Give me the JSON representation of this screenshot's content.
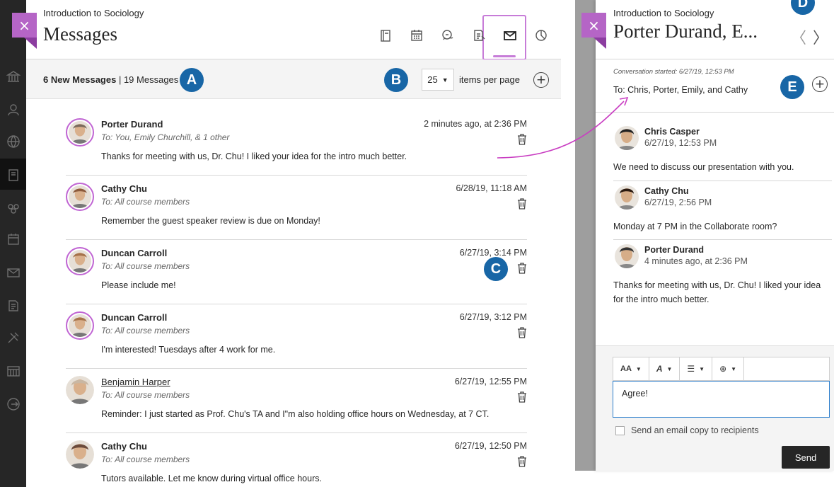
{
  "colors": {
    "accent_purple": "#b565c6",
    "badge_blue": "#1866a6",
    "arrow_magenta": "#c93ec2",
    "nav_dark": "#262626"
  },
  "left_nav": {
    "icons": [
      "institution-icon",
      "profile-icon",
      "globe-icon",
      "courses-icon",
      "organizations-icon",
      "calendar-icon",
      "messages-icon",
      "grades-icon",
      "tools-icon",
      "scheduler-icon",
      "signout-icon"
    ]
  },
  "messages_panel": {
    "breadcrumb": "Introduction to Sociology",
    "title": "Messages",
    "close_glyph": "×",
    "toolbar_icons": [
      "content-icon",
      "calendar-icon",
      "discussions-icon",
      "gradebook-icon",
      "messages-icon",
      "analytics-icon"
    ],
    "counts_bold": "6 New Messages",
    "counts_sep": " | ",
    "counts_total": "19 Messages",
    "per_page_value": "25",
    "per_page_label": "items per page",
    "plus_glyph": "+",
    "messages": [
      {
        "sender": "Porter Durand",
        "to": "To: You, Emily Churchill, & 1 other",
        "time": "2 minutes ago, at 2:36 PM",
        "body": "Thanks for meeting with us, Dr. Chu! I liked your idea for the intro much better.",
        "unread": true,
        "link": false
      },
      {
        "sender": "Cathy Chu",
        "to": "To: All course members",
        "time": "6/28/19, 11:18 AM",
        "body": "Remember the guest speaker review is due on Monday!",
        "unread": true,
        "link": false
      },
      {
        "sender": "Duncan Carroll",
        "to": "To: All course members",
        "time": "6/27/19, 3:14 PM",
        "body": "Please include me!",
        "unread": true,
        "link": false
      },
      {
        "sender": "Duncan Carroll",
        "to": "To: All course members",
        "time": "6/27/19, 3:12 PM",
        "body": "I'm interested! Tuesdays after 4 work for me.",
        "unread": true,
        "link": false
      },
      {
        "sender": "Benjamin Harper",
        "to": "To: All course members",
        "time": "6/27/19, 12:55 PM",
        "body": "Reminder: I just started as Prof. Chu's TA and I\"m also holding office hours on Wednesday, at 7 CT.",
        "unread": false,
        "link": true
      },
      {
        "sender": "Cathy Chu",
        "to": "To: All course members",
        "time": "6/27/19, 12:50 PM",
        "body": "Tutors available. Let me know during virtual office hours.",
        "unread": false,
        "link": false
      }
    ]
  },
  "conversation_panel": {
    "breadcrumb": "Introduction to Sociology",
    "title": "Porter Durand, E...",
    "close_glyph": "×",
    "prev_glyph": "〈",
    "next_glyph": "〉",
    "started": "Conversation started: 6/27/19, 12:53 PM",
    "to": "To: Chris, Porter, Emily, and Cathy",
    "plus_glyph": "+",
    "thread": [
      {
        "name": "Chris Casper",
        "time": "6/27/19, 12:53 PM",
        "body": "We need to discuss our presentation with you."
      },
      {
        "name": "Cathy Chu",
        "time": "6/27/19,  2:56 PM",
        "body": "Monday at 7 PM in the Collaborate room?"
      },
      {
        "name": "Porter Durand",
        "time": "4 minutes ago, at 2:36 PM",
        "body": "Thanks for meeting with us, Dr. Chu! I liked your idea for the intro much better."
      }
    ],
    "editor_tools": [
      {
        "icon": "font-size-icon",
        "label": "AA"
      },
      {
        "icon": "font-style-icon",
        "label": "A"
      },
      {
        "icon": "list-icon",
        "label": "☰"
      },
      {
        "icon": "insert-icon",
        "label": "⊕"
      }
    ],
    "editor_value": "Agree!",
    "email_copy_label": "Send an email copy to recipients",
    "send_label": "Send"
  },
  "callouts": [
    "A",
    "B",
    "C",
    "D",
    "E"
  ]
}
